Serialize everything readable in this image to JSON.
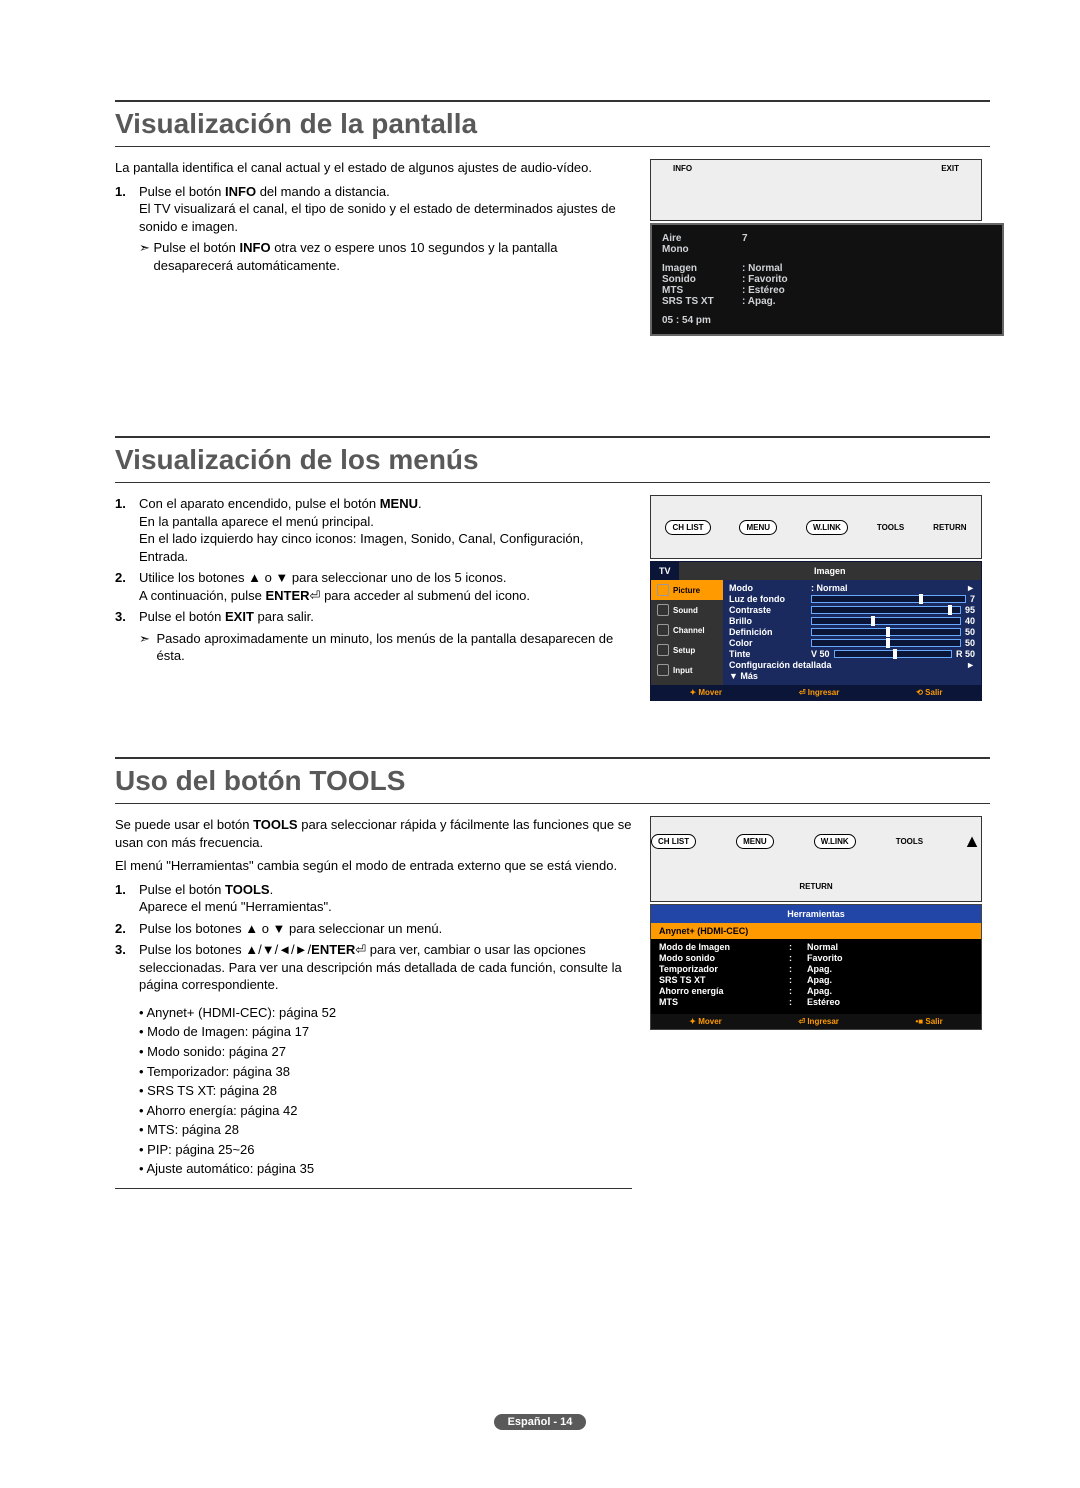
{
  "section1": {
    "title": "Visualización de la pantalla",
    "intro": "La pantalla identifica el canal actual y el estado de algunos ajustes de audio-vídeo.",
    "step1_num": "1.",
    "step1_a": "Pulse el botón ",
    "step1_b": "INFO",
    "step1_c": " del mando a distancia.",
    "step1_line2": "El TV visualizará el canal, el tipo de sonido y el estado de determinados ajustes de sonido e imagen.",
    "arrow": "➣",
    "step1_sub_a": "Pulse el botón ",
    "step1_sub_b": "INFO",
    "step1_sub_c": " otra vez o espere unos 10 segundos y la pantalla desaparecerá automáticamente.",
    "remote": {
      "info": "INFO",
      "exit": "EXIT"
    },
    "osd": {
      "aire_lbl": "Aire",
      "aire_val": "7",
      "mono": "Mono",
      "imagen_lbl": "Imagen",
      "imagen_val": ": Normal",
      "sonido_lbl": "Sonido",
      "sonido_val": ": Favorito",
      "mts_lbl": "MTS",
      "mts_val": ": Estéreo",
      "srs_lbl": "SRS TS XT",
      "srs_val": ": Apag.",
      "time": "05 : 54 pm"
    }
  },
  "section2": {
    "title": "Visualización de los menús",
    "step1_num": "1.",
    "step1_a": "Con el aparato encendido, pulse el botón ",
    "step1_b": "MENU",
    "step1_c": ".",
    "step1_l2": "En la pantalla aparece el menú principal.",
    "step1_l3": "En el lado izquierdo hay cinco iconos: Imagen, Sonido, Canal, Configuración, Entrada.",
    "step2_num": "2.",
    "step2_l1": "Utilice los botones ▲ o ▼ para seleccionar uno de los 5 iconos.",
    "step2_l2a": "A continuación, pulse ",
    "step2_l2b": "ENTER",
    "step2_l2c": " para acceder al submenú del icono.",
    "step3_num": "3.",
    "step3_a": "Pulse el botón ",
    "step3_b": "EXIT",
    "step3_c": " para salir.",
    "arrow": "➣",
    "step3_sub": "Pasado aproximadamente un minuto, los menús de la pantalla desaparecen de ésta.",
    "remote": {
      "chlist": "CH LIST",
      "menu": "MENU",
      "wlink": "W.LINK",
      "tools": "TOOLS",
      "return": "RETURN"
    },
    "osd": {
      "tv": "TV",
      "cat": "Imagen",
      "nav_picture": "Picture",
      "nav_sound": "Sound",
      "nav_channel": "Channel",
      "nav_setup": "Setup",
      "nav_input": "Input",
      "modo_lbl": "Modo",
      "modo_val": ": Normal",
      "luz_lbl": "Luz de fondo",
      "luz_val": "7",
      "contraste_lbl": "Contraste",
      "contraste_val": "95",
      "brillo_lbl": "Brillo",
      "brillo_val": "40",
      "def_lbl": "Definición",
      "def_val": "50",
      "color_lbl": "Color",
      "color_val": "50",
      "tinte_lbl": "Tinte",
      "tinte_pre": "V 50",
      "tinte_val": "R 50",
      "conf": "Configuración detallada",
      "mas": "▼ Más",
      "f_mover": "Mover",
      "f_ingresar": "Ingresar",
      "f_salir": "Salir"
    }
  },
  "section3": {
    "title": "Uso del botón TOOLS",
    "intro_a": "Se puede usar el botón ",
    "intro_b": "TOOLS",
    "intro_c": " para seleccionar rápida y fácilmente las funciones que se usan con más frecuencia.",
    "intro2": "El menú \"Herramientas\" cambia según el modo de entrada externo que se está viendo.",
    "step1_num": "1.",
    "step1_a": "Pulse el botón ",
    "step1_b": "TOOLS",
    "step1_c": ".",
    "step1_l2": "Aparece el menú \"Herramientas\".",
    "step2_num": "2.",
    "step2": "Pulse los botones ▲ o ▼ para seleccionar un menú.",
    "step3_num": "3.",
    "step3_a": "Pulse los botones ▲/▼/◄/►/",
    "step3_b": "ENTER",
    "step3_c": " para ver, cambiar o usar las opciones seleccionadas. Para ver una descripción más detallada de cada función, consulte la página correspondiente.",
    "bullets": [
      "• Anynet+ (HDMI-CEC): página 52",
      "• Modo de Imagen: página 17",
      "• Modo sonido: página 27",
      "• Temporizador: página 38",
      "• SRS TS XT: página 28",
      "• Ahorro energía: página 42",
      "• MTS: página 28",
      "• PIP: página 25~26",
      "• Ajuste automático: página 35"
    ],
    "remote": {
      "chlist": "CH LIST",
      "menu": "MENU",
      "wlink": "W.LINK",
      "tools": "TOOLS",
      "return": "RETURN"
    },
    "osd": {
      "title": "Herramientas",
      "hl": "Anynet+ (HDMI-CEC)",
      "r1_lbl": "Modo de Imagen",
      "r1_val": "Normal",
      "r2_lbl": "Modo sonido",
      "r2_val": "Favorito",
      "r3_lbl": "Temporizador",
      "r3_val": "Apag.",
      "r4_lbl": "SRS TS XT",
      "r4_val": "Apag.",
      "r5_lbl": "Ahorro energía",
      "r5_val": "Apag.",
      "r6_lbl": "MTS",
      "r6_val": "Estéreo",
      "f_mover": "Mover",
      "f_ingresar": "Ingresar",
      "f_salir": "Salir"
    }
  },
  "footer": "Español - 14"
}
